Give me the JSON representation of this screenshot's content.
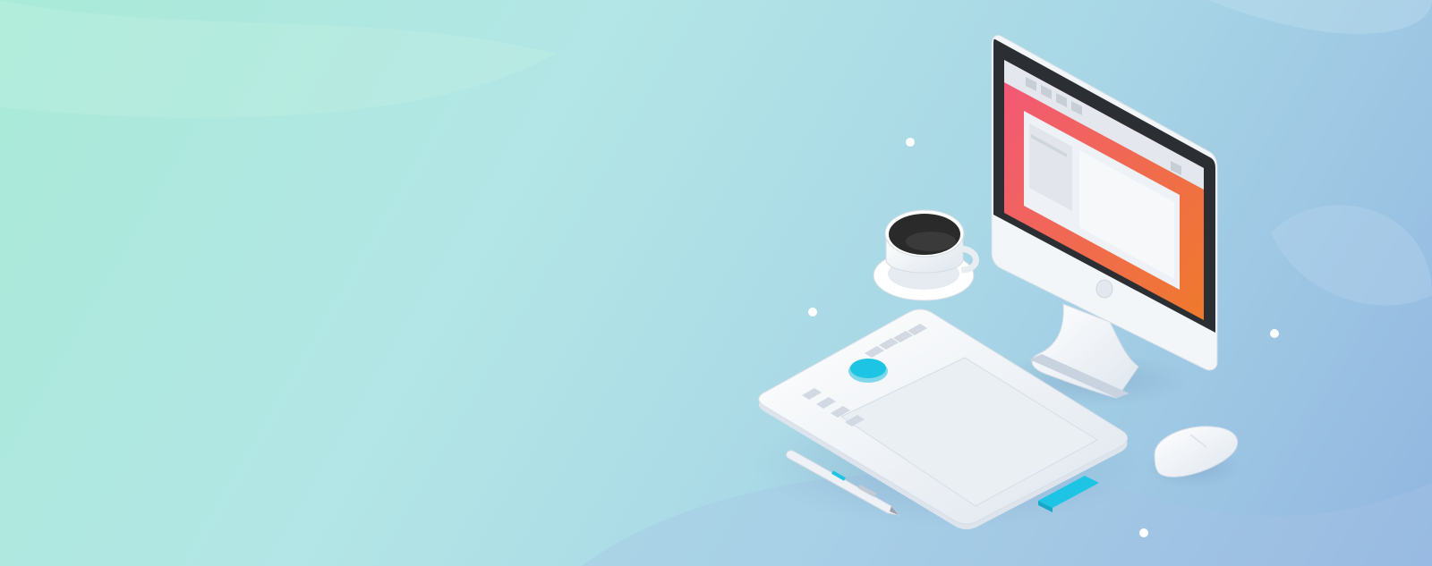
{
  "scene": {
    "subject": "isometric-desk-setup",
    "colors": {
      "bg_start": "#a9ead7",
      "bg_mid": "#b3e6e6",
      "bg_end": "#92b6e0",
      "screen_pink": "#f2577a",
      "screen_orange": "#ef7a2c",
      "accent_cyan": "#1ec4e4",
      "device_white": "#f1f4f7",
      "coffee": "#2a2a2a"
    },
    "icons": [
      "monitor-icon",
      "coffee-cup-icon",
      "drawing-tablet-icon",
      "stylus-pen-icon",
      "mouse-icon",
      "sparkle-dot-icon"
    ]
  }
}
